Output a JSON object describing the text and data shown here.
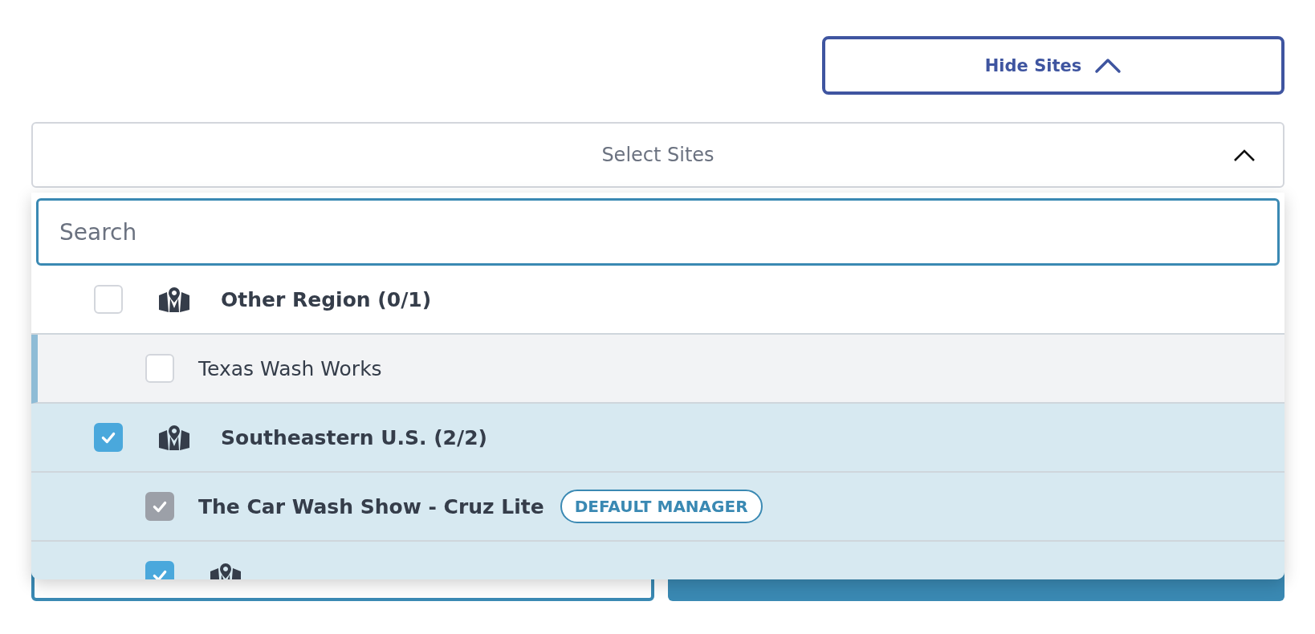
{
  "hide_button": {
    "label": "Hide Sites",
    "expanded": true
  },
  "select": {
    "placeholder": "Select Sites",
    "expanded": true
  },
  "search": {
    "placeholder": "Search"
  },
  "tree": [
    {
      "kind": "region",
      "label": "Other Region (0/1)",
      "checked": false,
      "highlighted": false,
      "children": [
        {
          "kind": "site",
          "label": "Texas Wash Works",
          "checked": false,
          "disabled": false,
          "highlighted": true
        }
      ]
    },
    {
      "kind": "region",
      "label": "Southeastern U.S. (2/2)",
      "checked": true,
      "highlighted": false,
      "children": [
        {
          "kind": "site",
          "label": "The Car Wash Show - Cruz Lite",
          "checked": true,
          "disabled": true,
          "highlighted": false,
          "badge": "DEFAULT MANAGER"
        },
        {
          "kind": "region",
          "checked": true,
          "highlighted": false
        }
      ]
    }
  ]
}
